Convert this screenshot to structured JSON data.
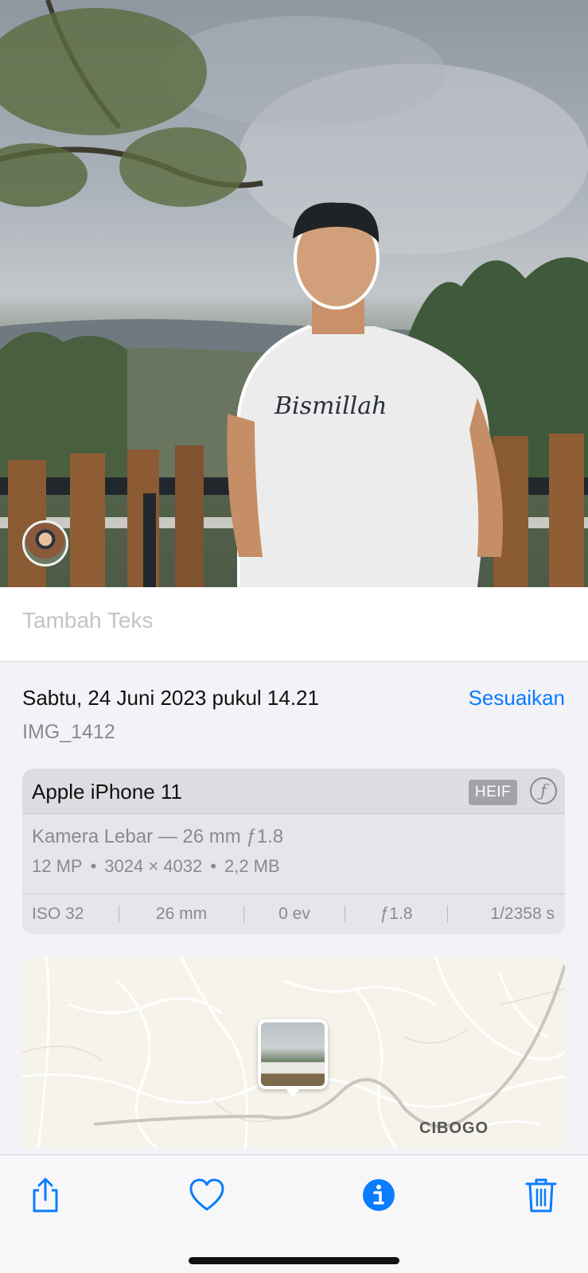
{
  "photo": {
    "alt": ""
  },
  "caption": {
    "placeholder": "Tambah Teks"
  },
  "info": {
    "date": "Sabtu, 24 Juni 2023 pukul 14.21",
    "adjust_label": "Sesuaikan",
    "filename": "IMG_1412"
  },
  "camera": {
    "device": "Apple iPhone 11",
    "format_badge": "HEIF",
    "aperture_icon": "ƒ",
    "lens": "Kamera Lebar — 26 mm ƒ1.8",
    "megapixels": "12 MP",
    "dimensions": "3024 × 4032",
    "size": "2,2 MB",
    "separator": "•",
    "exif": {
      "iso": "ISO 32",
      "focal": "26 mm",
      "exposure_bias": "0 ev",
      "aperture": "ƒ1.8",
      "shutter": "1/2358 s"
    }
  },
  "map": {
    "place_label": "CIBOGO"
  },
  "toolbar": {
    "share_icon": "share-icon",
    "favorite_icon": "heart-icon",
    "info_icon": "info-icon",
    "delete_icon": "trash-icon",
    "accent_color": "#0a7cff"
  }
}
